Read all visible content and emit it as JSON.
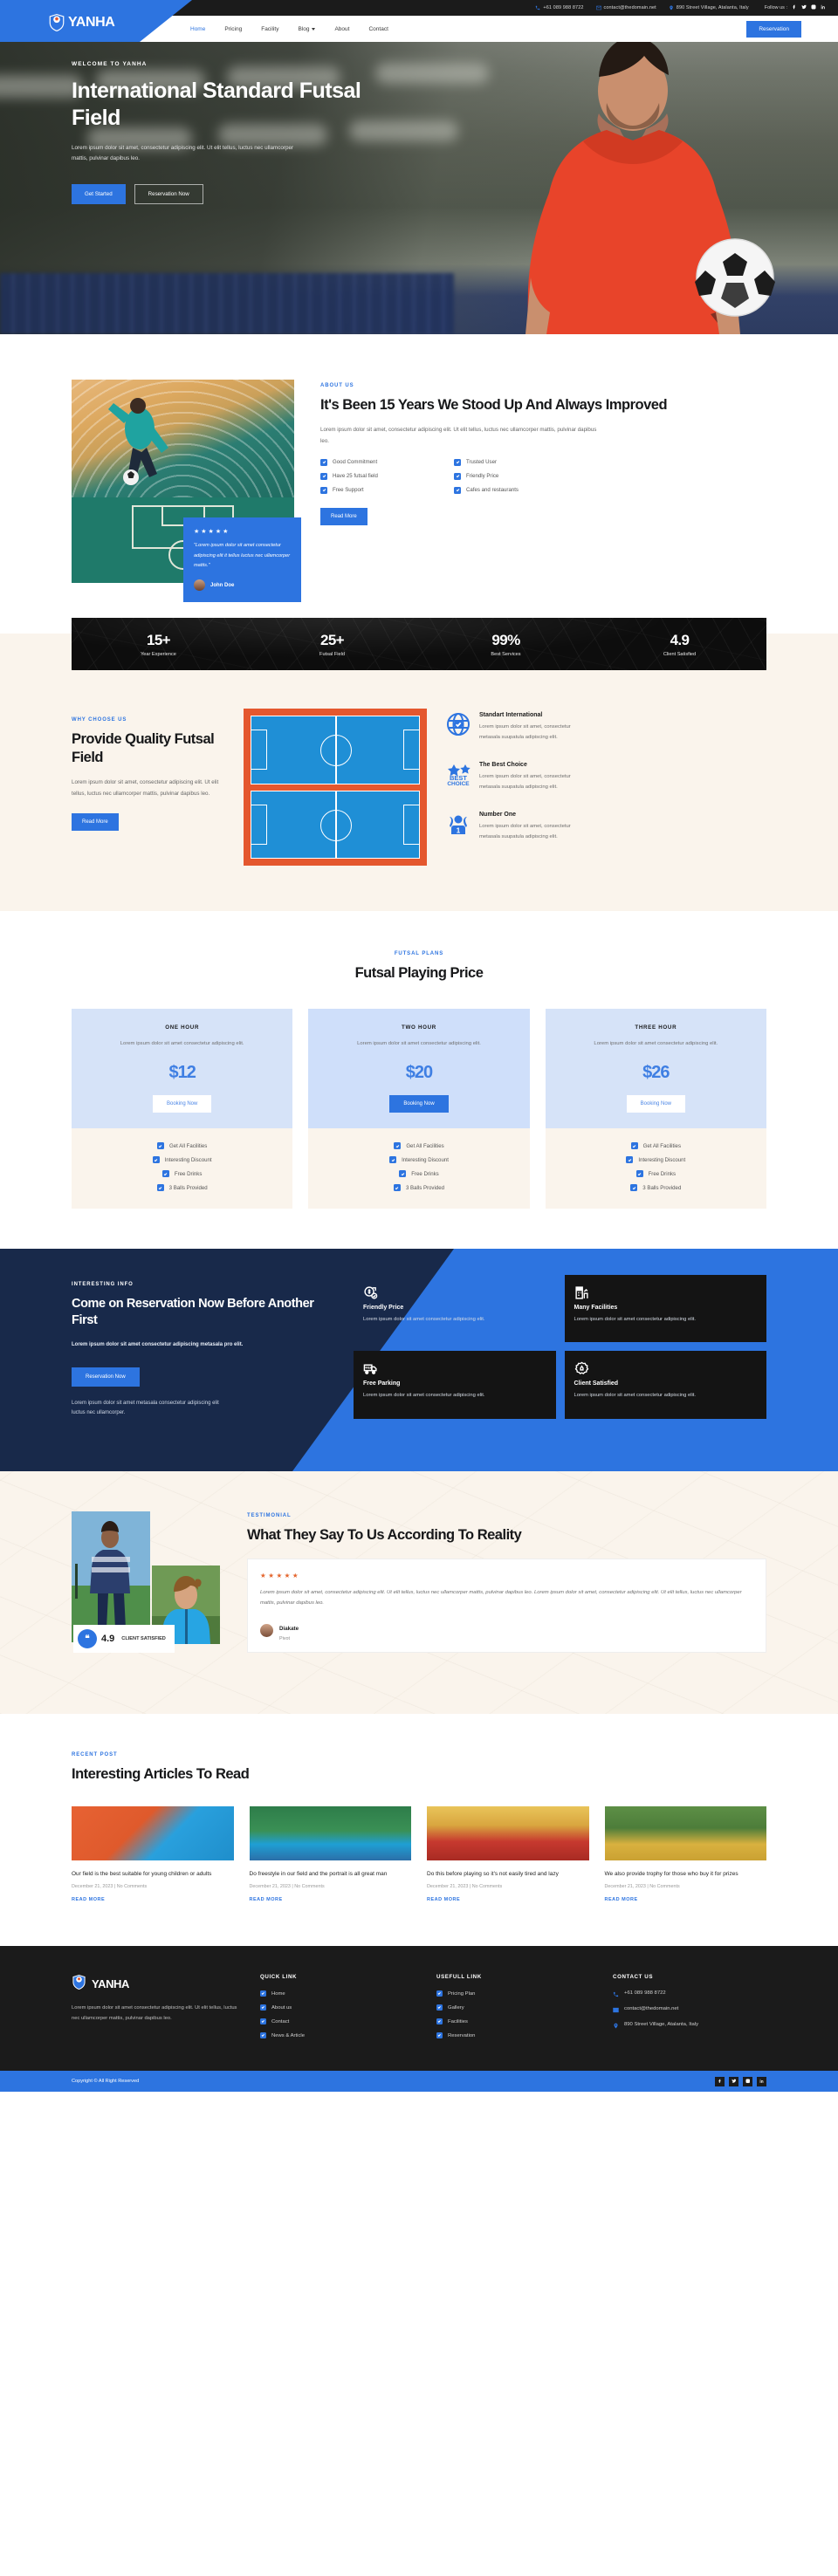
{
  "topbar": {
    "phone": "+61 089 988 8722",
    "email": "contact@thedomain.net",
    "address": "890 Street Village, Atalanta, Italy",
    "follow_label": "Follow us :"
  },
  "brand": {
    "name": "YANHA"
  },
  "nav": {
    "items": [
      {
        "label": "Home",
        "active": true
      },
      {
        "label": "Pricing",
        "active": false
      },
      {
        "label": "Facility",
        "active": false
      },
      {
        "label": "Blog",
        "active": false,
        "caret": true
      },
      {
        "label": "About",
        "active": false
      },
      {
        "label": "Contact",
        "active": false
      }
    ],
    "cta": "Reservation"
  },
  "hero": {
    "eyebrow": "WELCOME TO YANHA",
    "title": "International Standard Futsal Field",
    "desc": "Lorem ipsum dolor sit amet, consectetur adipiscing elit. Ut elit tellus, luctus nec ullamcorper mattis, pulvinar dapibus leo.",
    "btn_primary": "Get Started",
    "btn_secondary": "Reservation Now"
  },
  "about": {
    "eyebrow": "ABOUT US",
    "title": "It's Been 15 Years We Stood Up And Always Improved",
    "desc": "Lorem ipsum dolor sit amet, consectetur adipiscing elit. Ut elit tellus, luctus nec ullamcorper mattis, pulvinar dapibus leo.",
    "checks": [
      "Good Commitment",
      "Trusted User",
      "Have 25 futsal field",
      "Friendly Price",
      "Free Support",
      "Cafes and restaurants"
    ],
    "button": "Read More",
    "quote": {
      "stars": "★★★★★",
      "text": "\"Lorem ipsum dolor sit amet consectetur adipiscing elit it tellus luctus nec ullamcorper mattis.\"",
      "name": "John Doe"
    }
  },
  "stats": [
    {
      "num": "15+",
      "label": "Year Experience"
    },
    {
      "num": "25+",
      "label": "Futsal Field"
    },
    {
      "num": "99%",
      "label": "Best Services"
    },
    {
      "num": "4.9",
      "label": "Client Satisfied"
    }
  ],
  "why": {
    "eyebrow": "WHY CHOOSE US",
    "title": "Provide Quality Futsal Field",
    "desc": "Lorem ipsum dolor sit amet, consectetur adipiscing elit. Ut elit tellus, luctus nec ullamcorper mattis, pulvinar dapibus leo.",
    "button": "Read More",
    "features": [
      {
        "icon": "globe-check-icon",
        "title": "Standart International",
        "desc": "Lorem ipsum dolor sit amet, consectetur metasala suupatula adipiscing elit."
      },
      {
        "icon": "best-choice-icon",
        "title": "The Best Choice",
        "desc": "Lorem ipsum dolor sit amet, consectetur metasala suupatula adipiscing elit."
      },
      {
        "icon": "number-one-icon",
        "title": "Number One",
        "desc": "Lorem ipsum dolor sit amet, consectetur metasala suupatula adipiscing elit."
      }
    ]
  },
  "pricing": {
    "eyebrow": "FUTSAL PLANS",
    "title": "Futsal Playing Price",
    "plans": [
      {
        "name": "ONE HOUR",
        "desc": "Lorem ipsum dolor sit amet consectetur adipiscing elit.",
        "price": "$12",
        "button": "Booking Now",
        "features": [
          "Get All Facilities",
          "Interesting Discount",
          "Free Drinks",
          "3 Balls Provided"
        ],
        "featured": false
      },
      {
        "name": "TWO HOUR",
        "desc": "Lorem ipsum dolor sit amet consectetur adipiscing elit.",
        "price": "$20",
        "button": "Booking Now",
        "features": [
          "Get All Facilities",
          "Interesting Discount",
          "Free Drinks",
          "3 Balls Provided"
        ],
        "featured": true
      },
      {
        "name": "THREE HOUR",
        "desc": "Lorem ipsum dolor sit amet consectetur adipiscing elit.",
        "price": "$26",
        "button": "Booking Now",
        "features": [
          "Get All Facilities",
          "Interesting Discount",
          "Free Drinks",
          "3 Balls Provided"
        ],
        "featured": false
      }
    ]
  },
  "cta": {
    "eyebrow": "INTERESTING INFO",
    "title": "Come on Reservation Now Before Another First",
    "subtitle": "Lorem ipsum dolor sit amet consectetur adipiscing metasala pro elit.",
    "button": "Reservation Now",
    "footnote": "Lorem ipsum dolor sit amet metasala consectetur adipiscing elit luctus nec ullamcorper.",
    "cards": [
      {
        "icon": "price-tag-icon",
        "title": "Friendly Price",
        "desc": "Lorem ipsum dolor sit amet consectetur adipiscing elit.",
        "transparent": true
      },
      {
        "icon": "building-icon",
        "title": "Many Facilities",
        "desc": "Lorem ipsum dolor sit amet consectetur adipiscing elit.",
        "transparent": false
      },
      {
        "icon": "truck-free-icon",
        "title": "Free Parking",
        "desc": "Lorem ipsum dolor sit amet consectetur adipiscing elit.",
        "transparent": false
      },
      {
        "icon": "badge-like-icon",
        "title": "Client Satisfied",
        "desc": "Lorem ipsum dolor sit amet consectetur adipiscing elit.",
        "transparent": false
      }
    ]
  },
  "testimonial": {
    "eyebrow": "TESTIMONIAL",
    "title": "What They Say To Us According To Reality",
    "badge_score": "4.9",
    "badge_label": "CLIENT SATISFIED",
    "stars": "★★★★★",
    "quote": "Lorem ipsum dolor sit amet, consectetur adipiscing elit. Ut elit tellus, luctus nec ullamcorper mattis, pulvinar dapibus leo. Lorem ipsum dolor sit amet, consectetur adipiscing elit. Ut elit tellus, luctus nec ullamcorper mattis, pulvinar dapibus leo.",
    "name": "Diakate",
    "role": "Pivot"
  },
  "blog": {
    "eyebrow": "RECENT POST",
    "title": "Interesting Articles To Read",
    "posts": [
      {
        "title": "Our field is the best suitable for young children or adults",
        "meta": "December 21, 2023 | No Comments",
        "more": "READ MORE"
      },
      {
        "title": "Do freestyle in our field and the portrait is all great man",
        "meta": "December 21, 2023 | No Comments",
        "more": "READ MORE"
      },
      {
        "title": "Do this before playing so it's not easily tired and lazy",
        "meta": "December 21, 2023 | No Comments",
        "more": "READ MORE"
      },
      {
        "title": "We also provide trophy for those who buy it for prizes",
        "meta": "December 21, 2023 | No Comments",
        "more": "READ MORE"
      }
    ]
  },
  "footer": {
    "about": "Lorem ipsum dolor sit amet consectetur adipiscing elit. Ut elit tellus, luctus nec ullamcorper mattis, pulvinar dapibus leo.",
    "quick_link_title": "QUICK LINK",
    "quick_links": [
      "Home",
      "About us",
      "Contact",
      "News & Article"
    ],
    "useful_link_title": "USEFULL LINK",
    "useful_links": [
      "Pricing Plan",
      "Gallery",
      "Facilities",
      "Reservation"
    ],
    "contact_title": "CONTACT US",
    "contacts": [
      {
        "icon": "phone-icon",
        "text": "+61 089 988 8722"
      },
      {
        "icon": "mail-icon",
        "text": "contact@thedomain.net"
      },
      {
        "icon": "pin-icon",
        "text": "890 Street Village, Atalanta, Italy"
      }
    ],
    "copyright": "Copyright © All Right Reserved"
  },
  "colors": {
    "accent": "#2d74e0",
    "dark": "#1b1b1b",
    "navy": "#18294a",
    "cream": "#faf4ec"
  }
}
